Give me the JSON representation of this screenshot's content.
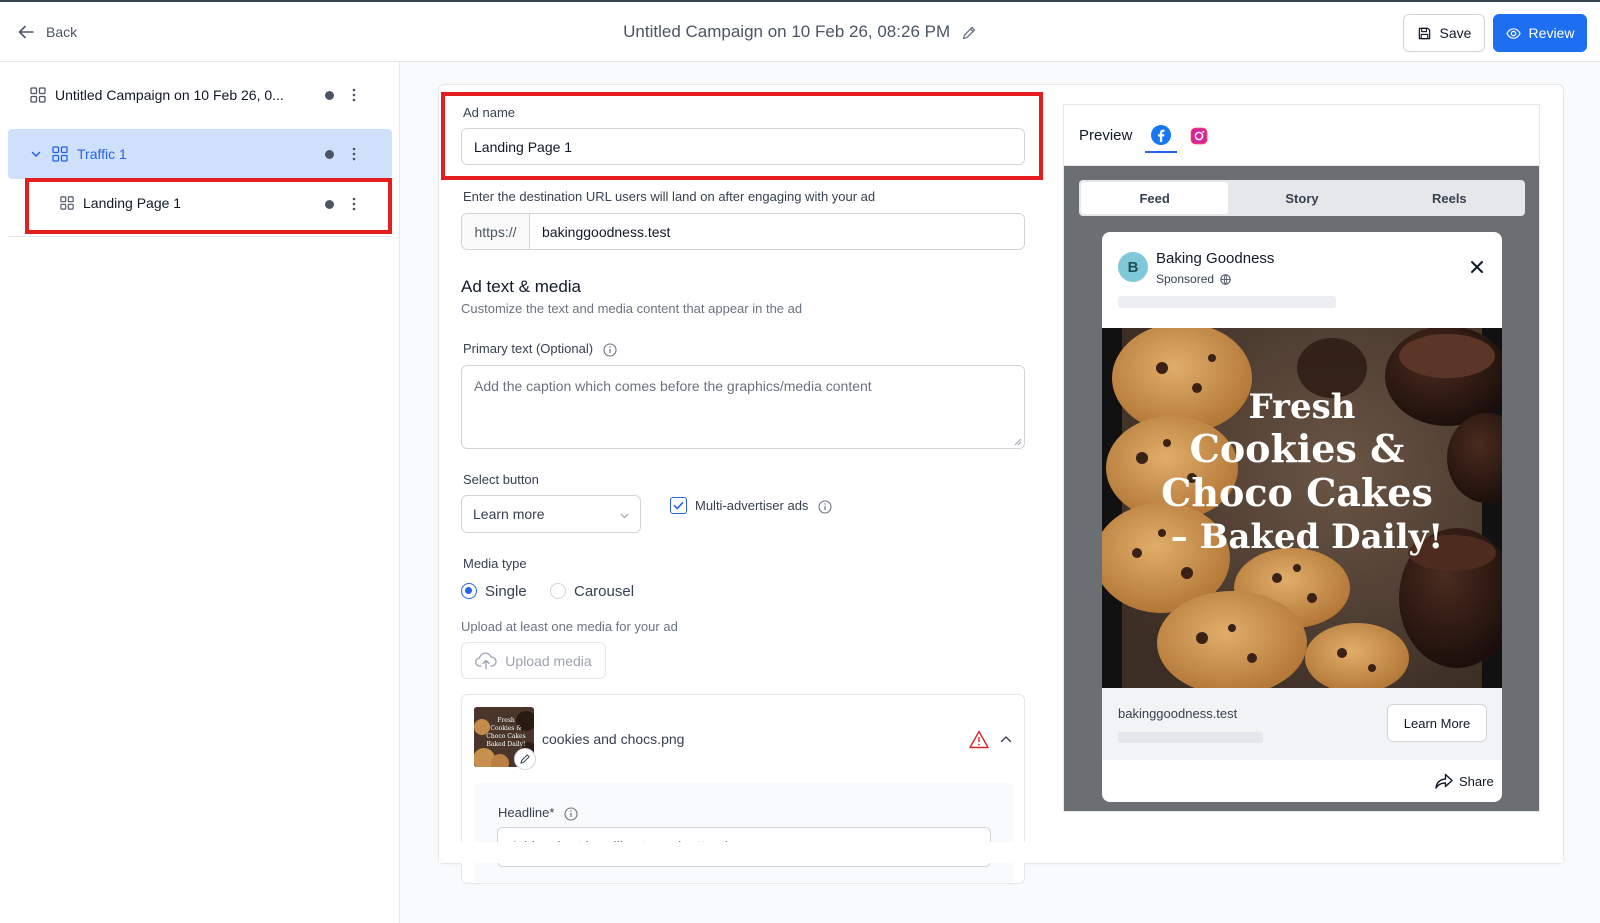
{
  "topbar": {
    "back_label": "Back",
    "title": "Untitled Campaign on 10 Feb 26, 08:26 PM",
    "save_label": "Save",
    "review_label": "Review"
  },
  "sidebar": {
    "campaign_label": "Untitled Campaign on 10 Feb 26, 0...",
    "adset_label": "Traffic 1",
    "ad_label": "Landing Page 1"
  },
  "form": {
    "ad_name_label": "Ad name",
    "ad_name_value": "Landing Page 1",
    "url_label": "Enter the destination URL users will land on after engaging with your ad",
    "url_prefix": "https://",
    "url_value": "bakinggoodness.test",
    "section_title": "Ad text & media",
    "section_subtitle": "Customize the text and media content that appear in the ad",
    "primary_text_label": "Primary text (Optional)",
    "primary_text_placeholder": "Add the caption which comes before the graphics/media content",
    "select_button_label": "Select button",
    "select_button_value": "Learn more",
    "multi_advertiser_label": "Multi-advertiser ads",
    "multi_advertiser_checked": true,
    "media_type_label": "Media type",
    "media_type_options": [
      "Single",
      "Carousel"
    ],
    "media_type_selected": "Single",
    "upload_hint": "Upload at least one media for your ad",
    "upload_button_label": "Upload media",
    "media_file_name": "cookies and chocs.png",
    "headline_label": "Headline*",
    "headline_placeholder": "Add a short headline to grab attention"
  },
  "preview": {
    "title": "Preview",
    "platform_tabs": [
      "facebook-icon",
      "instagram-icon"
    ],
    "placements": [
      "Feed",
      "Story",
      "Reels"
    ],
    "active_placement": "Feed",
    "page_name": "Baking Goodness",
    "page_initial": "B",
    "sponsored_label": "Sponsored",
    "image_text_lines": [
      "Fresh",
      "Cookies &",
      "Choco Cakes",
      "– Baked Daily!"
    ],
    "thumb_text_lines": [
      "Fresh",
      "Cookies &",
      "Choco Cakes",
      "Baked Daily!"
    ],
    "link_url": "bakinggoodness.test",
    "cta_label": "Learn More",
    "share_label": "Share"
  },
  "colors": {
    "primary": "#1d6ef0",
    "highlight": "#e41e1e",
    "selected_row": "#cfe0fb"
  }
}
